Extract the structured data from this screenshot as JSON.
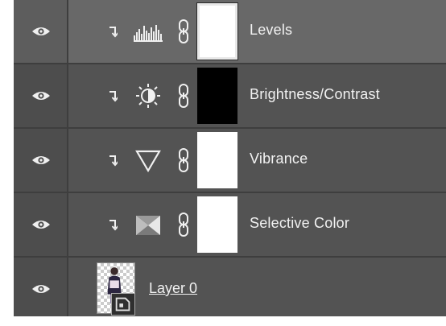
{
  "layers": [
    {
      "name": "Levels",
      "adjustment_icon": "levels-histogram-icon",
      "mask": "white",
      "selected": true
    },
    {
      "name": "Brightness/Contrast",
      "adjustment_icon": "brightness-contrast-icon",
      "mask": "black",
      "selected": false
    },
    {
      "name": "Vibrance",
      "adjustment_icon": "vibrance-triangle-icon",
      "mask": "white",
      "selected": false
    },
    {
      "name": "Selective Color",
      "adjustment_icon": "selective-color-icon",
      "mask": "white",
      "selected": false
    }
  ],
  "base_layer": {
    "name": "Layer 0",
    "thumbnail_icon": "smart-object-icon"
  },
  "colors": {
    "panel": "#535353",
    "selected_row": "#686868",
    "divider": "#3e3e3e",
    "text": "#f2f2f2"
  }
}
